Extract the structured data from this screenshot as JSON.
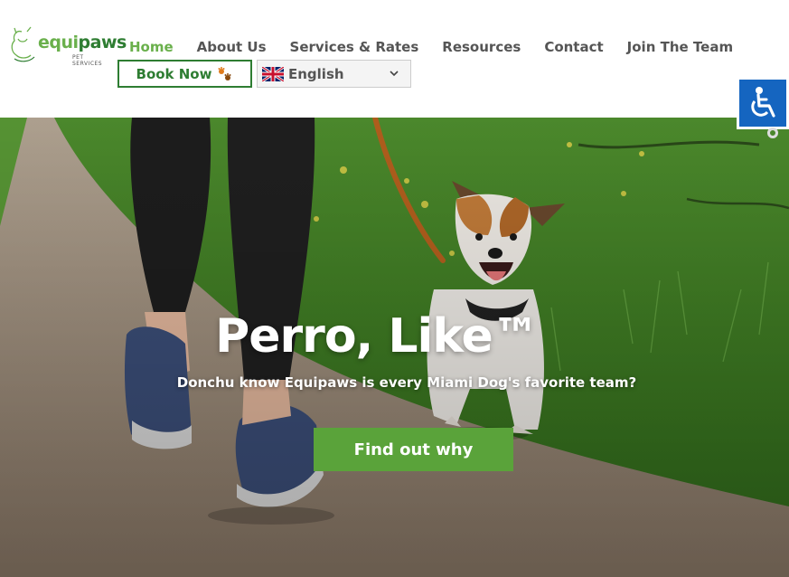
{
  "header": {
    "logo": {
      "brand_main": "equi",
      "brand_accent": "paws",
      "tagline": "PET SERVICES"
    },
    "nav": [
      {
        "label": "Home",
        "active": true
      },
      {
        "label": "About Us"
      },
      {
        "label": "Services & Rates"
      },
      {
        "label": "Resources"
      },
      {
        "label": "Contact"
      },
      {
        "label": "Join The Team"
      }
    ],
    "book_button": {
      "label": "Book Now",
      "icon": "paw-prints-icon"
    },
    "language": {
      "selected": "English",
      "flag": "uk-flag-icon"
    }
  },
  "accessibility": {
    "icon": "wheelchair-icon"
  },
  "hero": {
    "title": "Perro, Like™",
    "subtitle": "Donchu know Equipaws is every Miami Dog's favorite team?",
    "cta_label": "Find out why"
  },
  "colors": {
    "brand_green": "#6ab04c",
    "dark_green": "#2e7d32",
    "cta_green": "#5aa33a",
    "accessibility_blue": "#1565c0",
    "nav_text": "#555555"
  }
}
